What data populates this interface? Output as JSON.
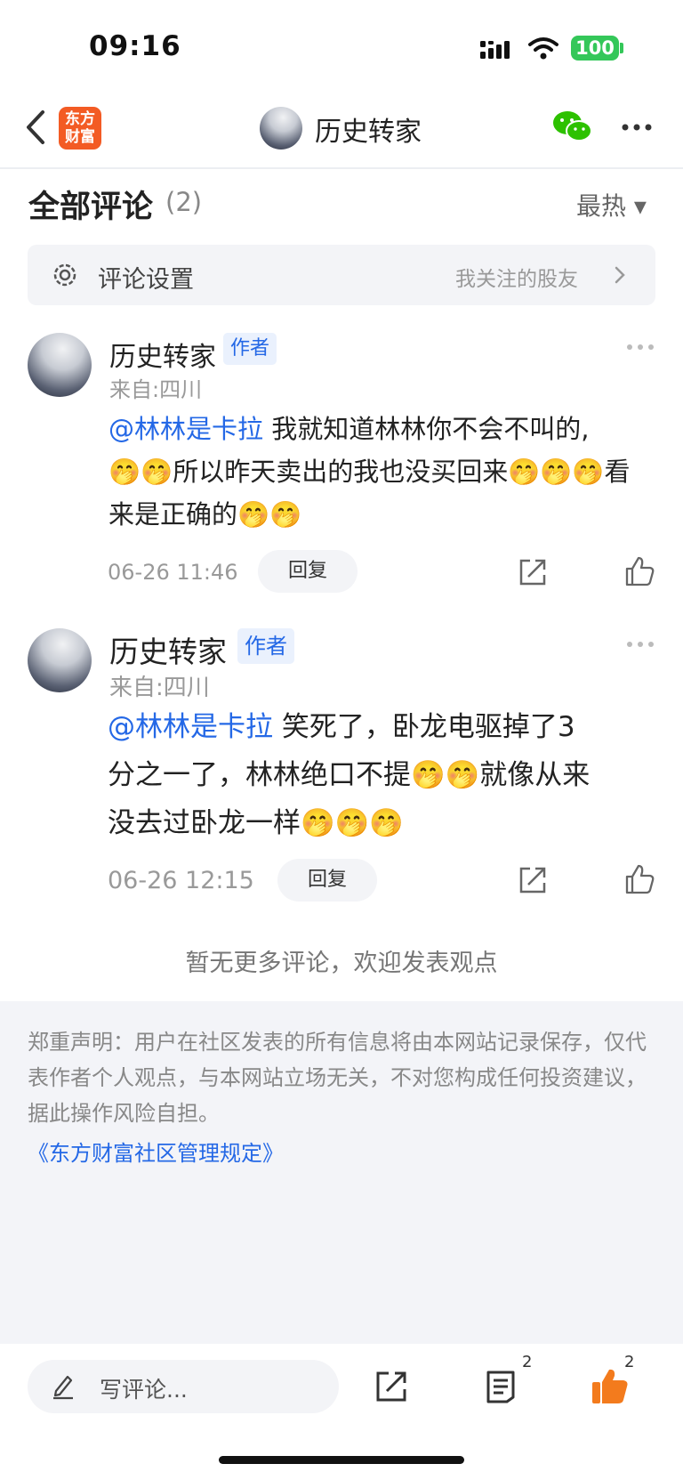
{
  "status_bar": {
    "time": "09:16",
    "battery": "100"
  },
  "nav": {
    "brand_line1": "东方",
    "brand_line2": "财富",
    "title": "历史转家",
    "more_icon": "ellipsis-icon",
    "wechat_icon": "wechat-icon"
  },
  "comments_header": {
    "title": "全部评论",
    "count": "(2)",
    "sort_label": "最热 ▾"
  },
  "settings": {
    "label": "评论设置",
    "right_label": "我关注的股友"
  },
  "comments": [
    {
      "name": "历史转家",
      "badge": "作者",
      "from": "来自:四川",
      "mention": "@林林是卡拉",
      "text_line1": " 我就知道林林你不会不叫的,",
      "text_line2": "🤭🤭所以昨天卖出的我也没买回来🤭🤭🤭看",
      "text_line3": "来是正确的🤭🤭",
      "date": "06-26 11:46",
      "reply": "回复"
    },
    {
      "name": "历史转家",
      "badge": "作者",
      "from": "来自:四川",
      "mention": "@林林是卡拉",
      "text_line1": " 笑死了，卧龙电驱掉了3",
      "text_line2": "分之一了，林林绝口不提🤭🤭就像从来",
      "text_line3": "没去过卧龙一样🤭🤭🤭",
      "date": "06-26 12:15",
      "reply": "回复"
    }
  ],
  "no_more": "暂无更多评论，欢迎发表观点",
  "disclaimer": "郑重声明：用户在社区发表的所有信息将由本网站记录保存，仅代表作者个人观点，与本网站立场无关，不对您构成任何投资建议，据此操作风险自担。",
  "rules_link": "《东方财富社区管理规定》",
  "bottom_bar": {
    "input_placeholder": "写评论...",
    "comment_count": "2",
    "like_count": "2"
  },
  "colors": {
    "brand_orange": "#f35b24",
    "link_blue": "#2468e6",
    "battery_green": "#34c759",
    "like_orange": "#f37b1d"
  }
}
